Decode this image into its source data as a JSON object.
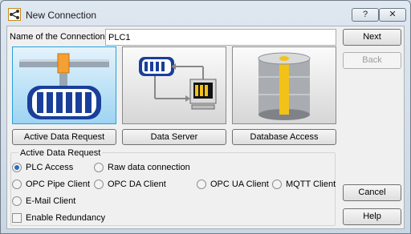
{
  "window": {
    "title": "New Connection",
    "help_button": "?",
    "close_button": "✕"
  },
  "form": {
    "name_label": "Name of the Connection",
    "name_value": "PLC1"
  },
  "sidebar_buttons": {
    "next": "Next",
    "back": "Back",
    "cancel": "Cancel",
    "help": "Help"
  },
  "tiles": [
    {
      "label": "Active Data Request",
      "icon": "active-data-request-icon",
      "selected": true
    },
    {
      "label": "Data Server",
      "icon": "data-server-icon",
      "selected": false
    },
    {
      "label": "Database Access",
      "icon": "database-icon",
      "selected": false
    }
  ],
  "group": {
    "title": "Active Data Request",
    "options": [
      {
        "label": "PLC Access",
        "checked": true
      },
      {
        "label": "Raw data connection",
        "checked": false
      },
      {
        "label": "OPC Pipe Client",
        "checked": false
      },
      {
        "label": "OPC DA Client",
        "checked": false
      },
      {
        "label": "OPC UA Client",
        "checked": false
      },
      {
        "label": "MQTT Client",
        "checked": false
      },
      {
        "label": "E-Mail Client",
        "checked": false
      }
    ],
    "redundancy_label": "Enable Redundancy",
    "redundancy_checked": false
  },
  "colors": {
    "selected_tile": "#9dd4f3",
    "database_stripe": "#f2c218",
    "pipe_blue": "#2a56b3"
  }
}
